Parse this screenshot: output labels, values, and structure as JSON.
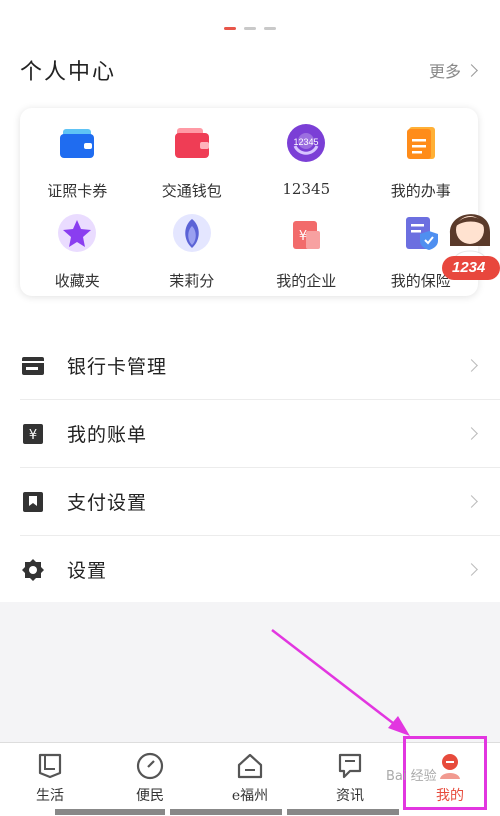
{
  "header": {
    "title": "个人中心",
    "more_label": "更多"
  },
  "services": [
    {
      "label": "证照卡券",
      "icon": "wallet-card-icon"
    },
    {
      "label": "交通钱包",
      "icon": "transit-wallet-icon"
    },
    {
      "label": "12345",
      "icon": "hotline-12345-icon"
    },
    {
      "label": "我的办事",
      "icon": "affairs-folder-icon"
    },
    {
      "label": "收藏夹",
      "icon": "star-favorites-icon"
    },
    {
      "label": "茉莉分",
      "icon": "jasmine-score-icon"
    },
    {
      "label": "我的企业",
      "icon": "enterprise-yuan-icon"
    },
    {
      "label": "我的保险",
      "icon": "insurance-shield-icon"
    }
  ],
  "menu": [
    {
      "label": "银行卡管理",
      "icon": "bank-card-icon"
    },
    {
      "label": "我的账单",
      "icon": "bill-yuan-icon"
    },
    {
      "label": "支付设置",
      "icon": "bookmark-icon"
    },
    {
      "label": "设置",
      "icon": "gear-icon"
    }
  ],
  "nav": [
    {
      "label": "生活",
      "icon": "life-icon"
    },
    {
      "label": "便民",
      "icon": "compass-icon"
    },
    {
      "label": "e福州",
      "icon": "home-icon"
    },
    {
      "label": "资讯",
      "icon": "news-flag-icon"
    },
    {
      "label": "我的",
      "icon": "profile-avatar-icon",
      "active": true
    }
  ],
  "assistant_badge": "1234",
  "watermark": "Bai 经验",
  "colors": {
    "accent": "#e74b3c",
    "highlight": "#e236e0"
  }
}
